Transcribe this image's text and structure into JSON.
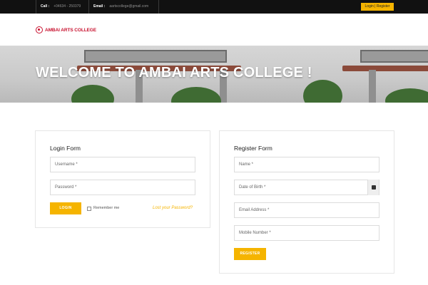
{
  "topbar": {
    "call_label": "Call :",
    "call_value": "+04634 - 250379",
    "email_label": "Email :",
    "email_value": "aartscollege@gmail.com",
    "login_register": "Login | Register"
  },
  "header": {
    "logo_text": "AMBAI ARTS COLLEGE"
  },
  "banner": {
    "title": "WELCOME TO AMBAI ARTS COLLEGE !"
  },
  "login_form": {
    "title": "Login Form",
    "username_placeholder": "Username *",
    "password_placeholder": "Password *",
    "login_button": "LOGIN",
    "remember_label": "Remember me",
    "forgot_link": "Lost your Password?"
  },
  "register_form": {
    "title": "Register Form",
    "name_placeholder": "Name *",
    "dob_placeholder": "Date of Birth *",
    "email_placeholder": "Email Address *",
    "mobile_placeholder": "Mobile Number *",
    "register_button": "REGISTER"
  },
  "colors": {
    "accent": "#f5b400",
    "topbar_bg": "#111111",
    "logo_red": "#c8102e"
  },
  "icons": [
    "college-emblem-icon",
    "calendar-icon",
    "checkbox-icon"
  ]
}
